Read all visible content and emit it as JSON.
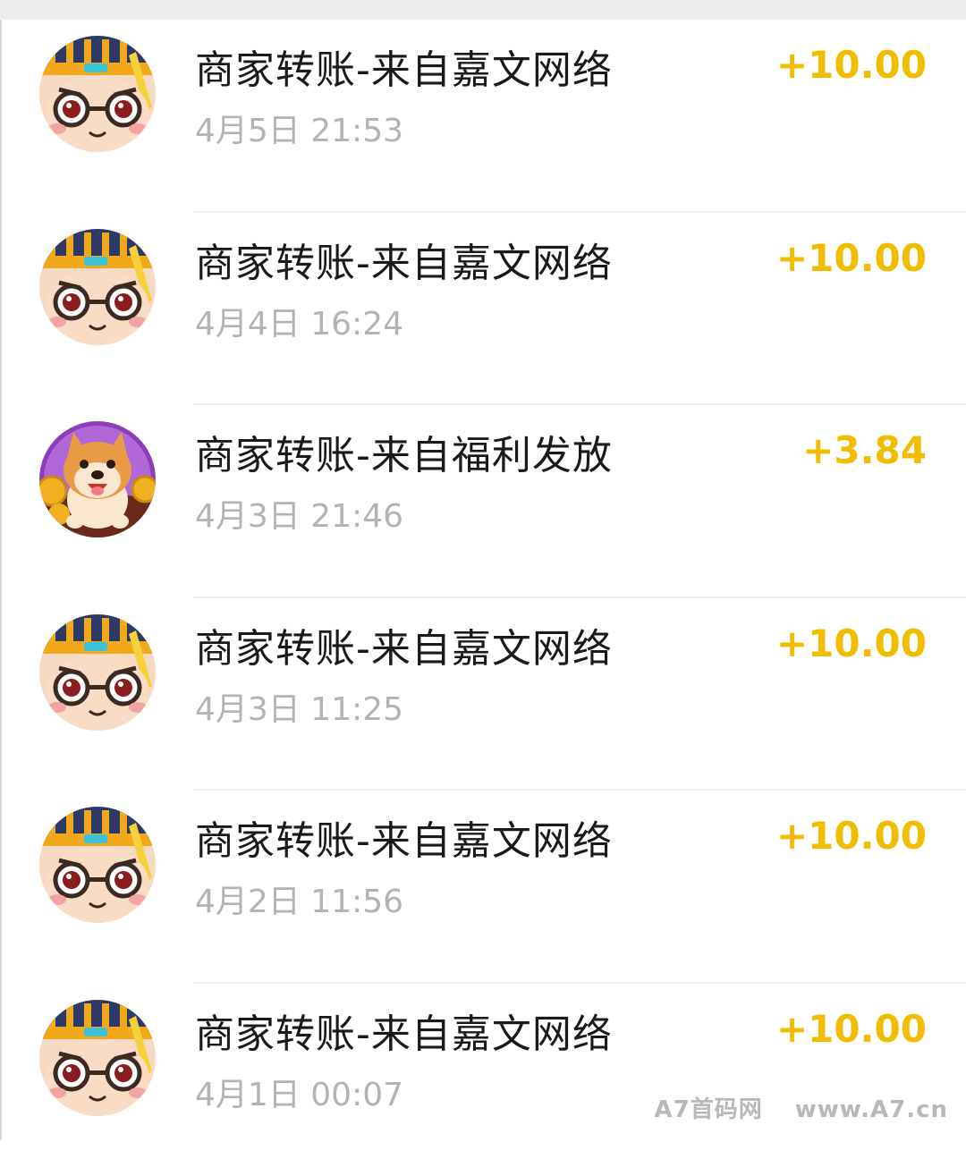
{
  "transactions": [
    {
      "title": "商家转账-来自嘉文网络",
      "time": "4月5日 21:53",
      "amount": "+10.00",
      "avatar": "cartoon-boy-glasses-avatar"
    },
    {
      "title": "商家转账-来自嘉文网络",
      "time": "4月4日 16:24",
      "amount": "+10.00",
      "avatar": "cartoon-boy-glasses-avatar"
    },
    {
      "title": "商家转账-来自福利发放",
      "time": "4月3日 21:46",
      "amount": "+3.84",
      "avatar": "shiba-dog-coins-avatar"
    },
    {
      "title": "商家转账-来自嘉文网络",
      "time": "4月3日 11:25",
      "amount": "+10.00",
      "avatar": "cartoon-boy-glasses-avatar"
    },
    {
      "title": "商家转账-来自嘉文网络",
      "time": "4月2日 11:56",
      "amount": "+10.00",
      "avatar": "cartoon-boy-glasses-avatar"
    },
    {
      "title": "商家转账-来自嘉文网络",
      "time": "4月1日 00:07",
      "amount": "+10.00",
      "avatar": "cartoon-boy-glasses-avatar"
    }
  ],
  "colors": {
    "amount": "#f2bd00",
    "title": "#1a1a1a",
    "time": "#b3b3b3"
  },
  "watermark": {
    "brand": "A7首码网",
    "url": "www.A7.cn"
  }
}
